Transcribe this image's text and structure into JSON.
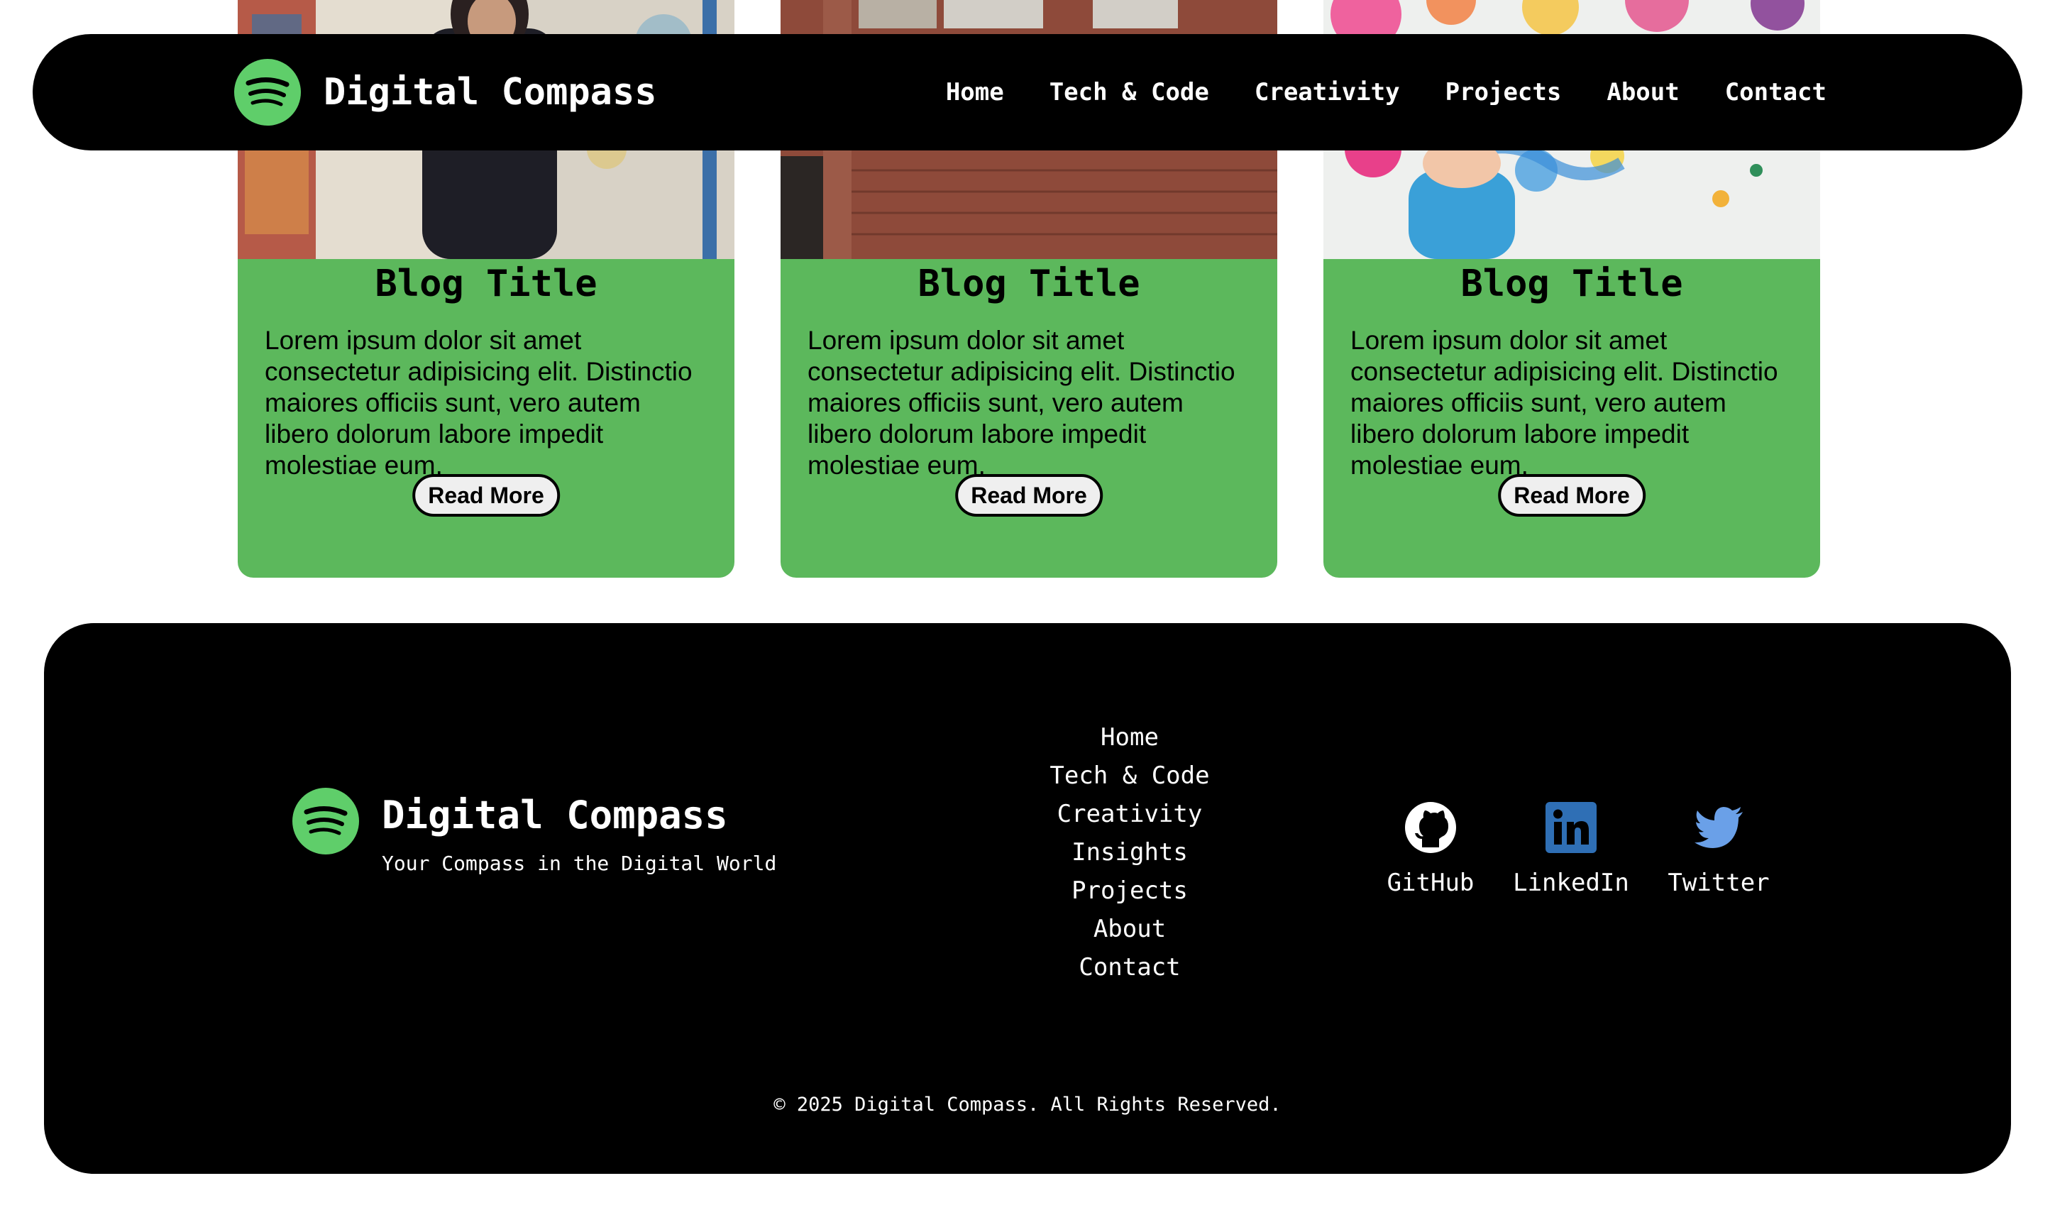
{
  "header": {
    "brand": "Digital Compass",
    "nav": [
      "Home",
      "Tech & Code",
      "Creativity",
      "Projects",
      "About",
      "Contact"
    ]
  },
  "cards": [
    {
      "title": "Blog Title",
      "text": "Lorem ipsum dolor sit amet consectetur adipisicing elit. Distinctio maiores officiis sunt, vero autem libero dolorum labore impedit molestiae eum.",
      "button": "Read More"
    },
    {
      "title": "Blog Title",
      "text": "Lorem ipsum dolor sit amet consectetur adipisicing elit. Distinctio maiores officiis sunt, vero autem libero dolorum labore impedit molestiae eum.",
      "button": "Read More"
    },
    {
      "title": "Blog Title",
      "text": "Lorem ipsum dolor sit amet consectetur adipisicing elit. Distinctio maiores officiis sunt, vero autem libero dolorum labore impedit molestiae eum.",
      "button": "Read More"
    }
  ],
  "footer": {
    "brand": "Digital Compass",
    "tagline": "Your Compass in the Digital World",
    "nav": [
      "Home",
      "Tech & Code",
      "Creativity",
      "Insights",
      "Projects",
      "About",
      "Contact"
    ],
    "social": [
      {
        "label": "GitHub",
        "icon": "github-icon"
      },
      {
        "label": "LinkedIn",
        "icon": "linkedin-icon"
      },
      {
        "label": "Twitter",
        "icon": "twitter-icon"
      }
    ],
    "copyright": "© 2025 Digital Compass. All Rights Reserved."
  },
  "colors": {
    "accent_green": "#5cb85c",
    "logo_green": "#5fce6a",
    "linkedin_blue": "#2f6fb5",
    "twitter_blue": "#6aa0e8",
    "header_bg": "#000000"
  }
}
